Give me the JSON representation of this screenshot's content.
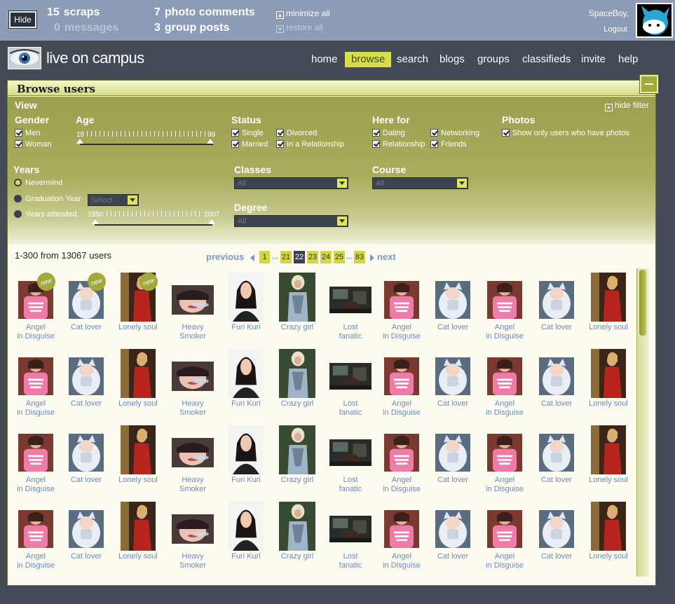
{
  "topbar": {
    "hide_label": "Hide",
    "scraps": {
      "count": "15",
      "label": "scraps"
    },
    "messages": {
      "count": "0",
      "label": "messages"
    },
    "photo_comments": {
      "count": "7",
      "label": "photo comments"
    },
    "group_posts": {
      "count": "3",
      "label": "group posts"
    },
    "minimize_all": "minimize all",
    "restore_all": "restore all",
    "username": "SpaceBoy,",
    "logout": "Logout"
  },
  "header": {
    "logo_text": "live on campus",
    "nav": [
      {
        "label": "home",
        "active": false
      },
      {
        "label": "browse",
        "active": true
      },
      {
        "label": "search",
        "active": false
      },
      {
        "label": "blogs",
        "active": false
      },
      {
        "label": "groups",
        "active": false
      },
      {
        "label": "classifieds",
        "active": false
      },
      {
        "label": "invite",
        "active": false
      },
      {
        "label": "help",
        "active": false
      }
    ]
  },
  "panel": {
    "title": "Browse users",
    "filter": {
      "view_label": "View",
      "hide_filter": "hide filter",
      "gender": {
        "label": "Gender",
        "options": [
          "Men",
          "Woman"
        ]
      },
      "age": {
        "label": "Age",
        "min": "18",
        "max": "99"
      },
      "status": {
        "label": "Status",
        "options": [
          "Single",
          "Divorced",
          "Married",
          "In a Relationship"
        ]
      },
      "here_for": {
        "label": "Here for",
        "options": [
          "Dating",
          "Networking",
          "Relationship",
          "Friends"
        ]
      },
      "photos": {
        "label": "Photos",
        "option": "Show only users who have photos"
      },
      "years": {
        "label": "Years",
        "options": [
          "Nevermind",
          "Graduation Year",
          "Years attended"
        ],
        "graduation_select": "Select",
        "attended_min": "1950",
        "attended_max": "2007"
      },
      "classes": {
        "label": "Classes",
        "value": "All"
      },
      "course": {
        "label": "Course",
        "value": "All"
      },
      "degree": {
        "label": "Degree",
        "value": "All"
      }
    },
    "results": {
      "summary": "1-300 from 13067 users",
      "previous": "previous",
      "next": "next",
      "pages": [
        "1",
        "21",
        "22",
        "23",
        "24",
        "25",
        "83"
      ],
      "current_page": "22"
    },
    "users_row": [
      {
        "name": "Angel\nin Disguise",
        "photo": "pink-shirt-girl",
        "new": true
      },
      {
        "name": "Cat lover",
        "photo": "white-cat",
        "new": true
      },
      {
        "name": "Lonely soul",
        "photo": "red-dress-girl",
        "new": true
      },
      {
        "name": "Heavy\nSmoker",
        "photo": "smoking-girl",
        "new": false
      },
      {
        "name": "Furi Kuri",
        "photo": "dark-hair-girl",
        "new": false
      },
      {
        "name": "Crazy girl",
        "photo": "blonde-girl",
        "new": false
      },
      {
        "name": "Lost\nfanatic",
        "photo": "dark-room",
        "new": false
      },
      {
        "name": "Angel\nin Disguise",
        "photo": "pink-shirt-girl",
        "new": false
      },
      {
        "name": "Cat lover",
        "photo": "white-cat",
        "new": false
      },
      {
        "name": "Angel\nin Disguise",
        "photo": "pink-shirt-girl",
        "new": false
      },
      {
        "name": "Cat lover",
        "photo": "white-cat",
        "new": false
      },
      {
        "name": "Lonely soul",
        "photo": "red-dress-girl",
        "new": false
      }
    ],
    "new_badge": "new",
    "colors": {
      "accent": "#d7de47",
      "panel": "#a9ad5d",
      "topbar": "#8d9cb6",
      "background": "#434a56",
      "link": "#6d8ac0"
    }
  }
}
